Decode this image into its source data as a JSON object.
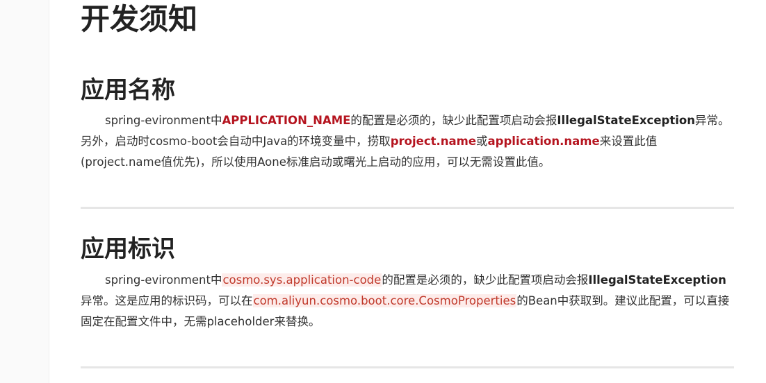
{
  "doc": {
    "title": "开发须知"
  },
  "sections": [
    {
      "title": "应用名称",
      "parts": {
        "t1": "spring-evironment中",
        "k1": "APPLICATION_NAME",
        "t2": "的配置是必须的，缺少此配置项启动会报",
        "b1": "IllegalStateException",
        "t3": "异常。另外，启动时cosmo-boot会自动中Java的环境变量中，捞取",
        "k2": "project.name",
        "t4": "或",
        "k3": "application.name",
        "t5": "来设置此值(project.name值优先)，所以使用Aone标准启动或曙光上启动的应用，可以无需设置此值。"
      }
    },
    {
      "title": "应用标识",
      "parts": {
        "t1": "spring-evironment中",
        "c1": "cosmo.sys.application-code",
        "t2": "的配置是必须的，缺少此配置项启动会报",
        "b1": "IllegalStateException",
        "t3": "异常。这是应用的标识码，可以在",
        "c2": "com.aliyun.cosmo.boot.core.CosmoProperties",
        "t4": "的Bean中获取到。建议此配置，可以直接固定在配置文件中，无需placeholder来替换。"
      }
    }
  ]
}
